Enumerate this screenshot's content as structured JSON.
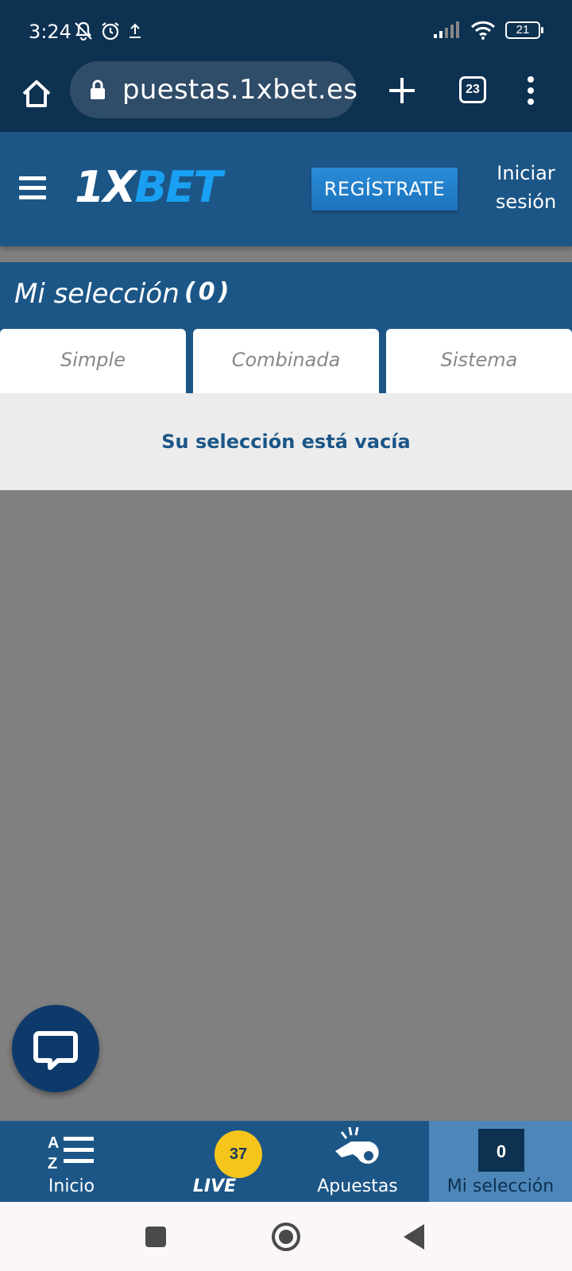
{
  "status_bar": {
    "time": "3:24",
    "battery": "21"
  },
  "browser": {
    "url": "puestas.1xbet.es",
    "tab_count": "23"
  },
  "header": {
    "logo_one": "1X",
    "logo_bet": "BET",
    "register_label": "REGÍSTRATE",
    "login_label_1": "Iniciar",
    "login_label_2": "sesión"
  },
  "selection": {
    "title": "Mi selección",
    "count": "(0)",
    "tabs": [
      {
        "label": "Simple"
      },
      {
        "label": "Combinada"
      },
      {
        "label": "Sistema"
      }
    ],
    "empty_message": "Su selección está vacía"
  },
  "bottom_nav": {
    "inicio": {
      "label": "Inicio",
      "icon": "az-list-icon"
    },
    "live": {
      "label": "LIVE",
      "badge": "37"
    },
    "apuestas": {
      "label": "Apuestas",
      "icon": "whistle-icon"
    },
    "mi_seleccion": {
      "label": "Mi selección",
      "count": "0"
    }
  },
  "colors": {
    "status_bar": "#0d3151",
    "header": "#1c5687",
    "register_button": "#1c73bd",
    "logo_accent": "#1aa0f2",
    "live_badge": "#f5c51c",
    "overlay": "#808080",
    "active_nav": "#4d87b9"
  }
}
